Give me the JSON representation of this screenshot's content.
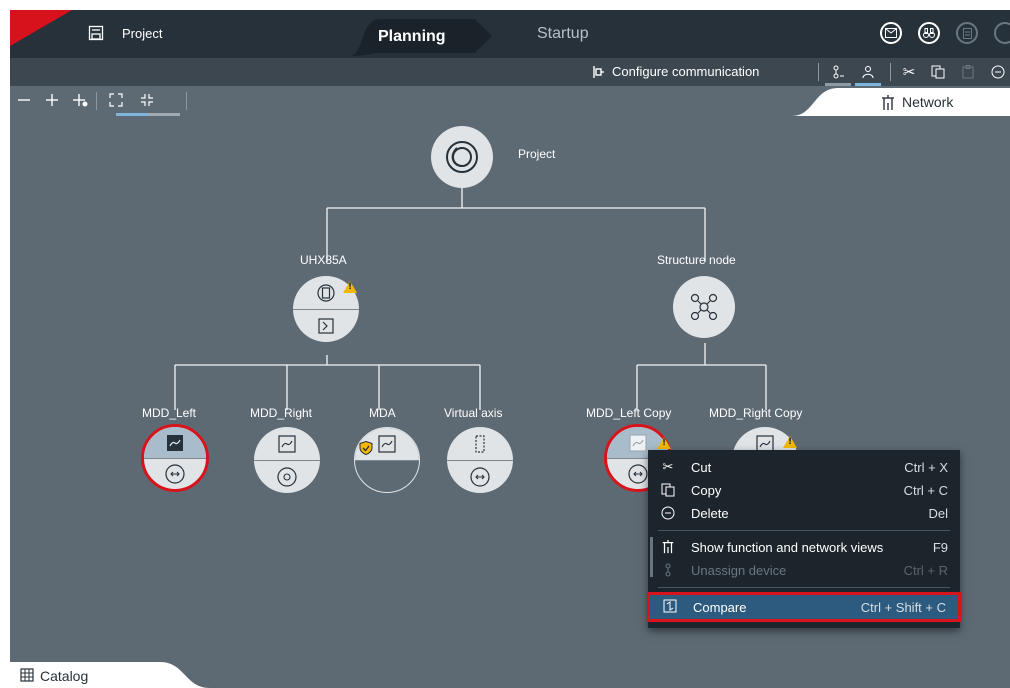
{
  "header": {
    "project_label": "Project",
    "tabs": [
      {
        "label": "Planning",
        "active": true
      },
      {
        "label": "Startup",
        "active": false
      }
    ],
    "right_icons": [
      "mail-icon",
      "binoculars-icon",
      "document-icon",
      "document-icon"
    ]
  },
  "toolbar": {
    "configure_communication": "Configure communication",
    "view_icons": [
      "function-view-icon",
      "user-view-icon"
    ],
    "edit_icons": [
      "cut-icon",
      "copy-icon",
      "paste-icon",
      "delete-icon"
    ]
  },
  "zoom_bar": {
    "buttons": [
      "zoom-out-icon",
      "zoom-in-icon",
      "add-node-icon",
      "expand-icon",
      "collapse-icon"
    ]
  },
  "view_tab": {
    "label": "Network"
  },
  "tree": {
    "root": {
      "label": "Project"
    },
    "groups": [
      {
        "label": "UHX85A",
        "warning": true,
        "children": [
          {
            "label": "MDD_Left",
            "selected": true
          },
          {
            "label": "MDD_Right",
            "selected": false
          },
          {
            "label": "MDA",
            "selected": false
          },
          {
            "label": "Virtual axis",
            "selected": false
          }
        ]
      },
      {
        "label": "Structure node",
        "warning": false,
        "children": [
          {
            "label": "MDD_Left Copy",
            "selected": true,
            "warning": true
          },
          {
            "label": "MDD_Right Copy",
            "selected": false,
            "warning": true
          }
        ]
      }
    ]
  },
  "context_menu": {
    "items": [
      {
        "label": "Cut",
        "shortcut": "Ctrl + X",
        "icon": "cut-icon",
        "enabled": true
      },
      {
        "label": "Copy",
        "shortcut": "Ctrl + C",
        "icon": "copy-icon",
        "enabled": true
      },
      {
        "label": "Delete",
        "shortcut": "Del",
        "icon": "delete-icon",
        "enabled": true
      },
      {
        "label": "Show function and network views",
        "shortcut": "F9",
        "icon": "network-icon",
        "enabled": true
      },
      {
        "label": "Unassign device",
        "shortcut": "Ctrl + R",
        "icon": "unassign-icon",
        "enabled": false
      },
      {
        "label": "Compare",
        "shortcut": "Ctrl + Shift + C",
        "icon": "compare-icon",
        "enabled": true,
        "highlighted": true
      }
    ]
  },
  "catalog": {
    "label": "Catalog"
  },
  "colors": {
    "accent_red": "#d7121c",
    "header_bg": "#27313a",
    "canvas_bg": "#5e6a73",
    "menu_bg": "#1d252c",
    "menu_highlight": "#2d5b80",
    "underline_blue": "#7fb4dc",
    "warning_yellow": "#f3b800"
  }
}
